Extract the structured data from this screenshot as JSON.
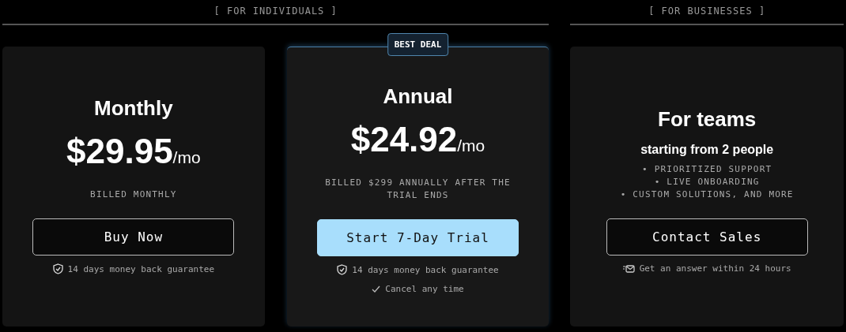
{
  "groups": [
    {
      "label": "[ FOR INDIVIDUALS ]",
      "plans": [
        {
          "kind": "price",
          "featured": false,
          "title": "Monthly",
          "price": "$29.95",
          "unit": "/mo",
          "billing": "BILLED MONTHLY",
          "button": {
            "label": "Buy Now",
            "kind": "outline"
          },
          "notes": [
            {
              "kind": "shield",
              "text": "14 days money back guarantee"
            }
          ]
        },
        {
          "kind": "price",
          "featured": true,
          "badge": "BEST DEAL",
          "title": "Annual",
          "price": "$24.92",
          "unit": "/mo",
          "billing": "BILLED $299 ANNUALLY AFTER THE TRIAL ENDS",
          "button": {
            "label": "Start 7-Day Trial",
            "kind": "primary"
          },
          "notes": [
            {
              "kind": "shield",
              "text": "14 days money back guarantee"
            },
            {
              "kind": "check",
              "text": "Cancel any time"
            }
          ]
        }
      ]
    },
    {
      "label": "[ FOR BUSINESSES ]",
      "plans": [
        {
          "kind": "contact",
          "featured": false,
          "title": "For teams",
          "subtitle": "starting from 2 people",
          "features": [
            "• PRIORITIZED SUPPORT",
            "• LIVE ONBOARDING",
            "• CUSTOM SOLUTIONS, AND MORE"
          ],
          "button": {
            "label": "Contact Sales",
            "kind": "outline"
          },
          "notes": [
            {
              "kind": "mail",
              "text": "Get an answer within 24 hours"
            }
          ]
        }
      ]
    }
  ]
}
